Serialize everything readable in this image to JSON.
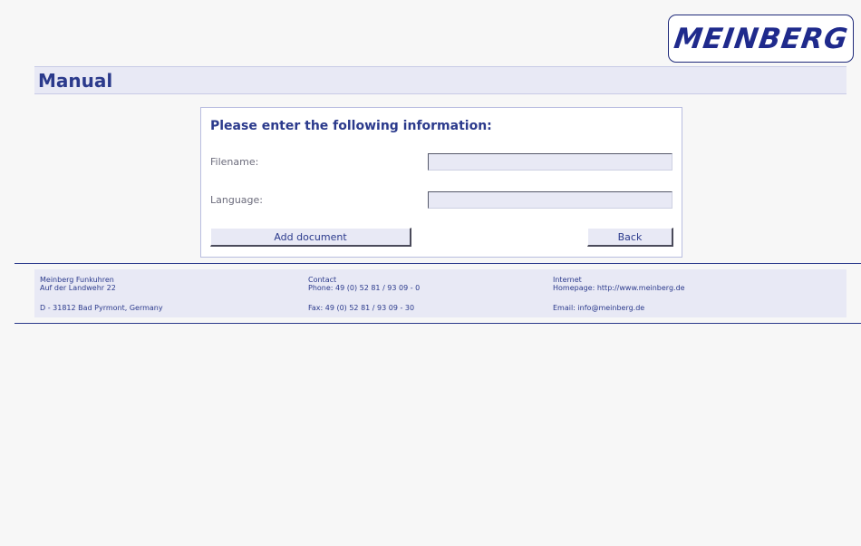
{
  "logo": {
    "text": "MEINBERG"
  },
  "page": {
    "title": "Manual"
  },
  "form": {
    "heading": "Please enter the following information:",
    "filename_label": "Filename:",
    "filename_value": "",
    "language_label": "Language:",
    "language_value": "",
    "add_button": "Add document",
    "back_button": "Back"
  },
  "footer": {
    "company": {
      "line1": "Meinberg Funkuhren",
      "line2": "Auf der Landwehr 22",
      "line3": "D - 31812 Bad Pyrmont, Germany"
    },
    "contact": {
      "line1": "Contact",
      "line2": "Phone: 49 (0) 52 81 / 93 09 - 0",
      "line3": "Fax: 49 (0) 52 81 / 93 09 - 30"
    },
    "internet": {
      "line1": "Internet",
      "line2": "Homepage: http://www.meinberg.de",
      "line3": "Email: info@meinberg.de"
    }
  },
  "colors": {
    "accent": "#2b3a8c",
    "panel_bg": "#e8e9f5",
    "page_bg": "#f7f7f7"
  }
}
